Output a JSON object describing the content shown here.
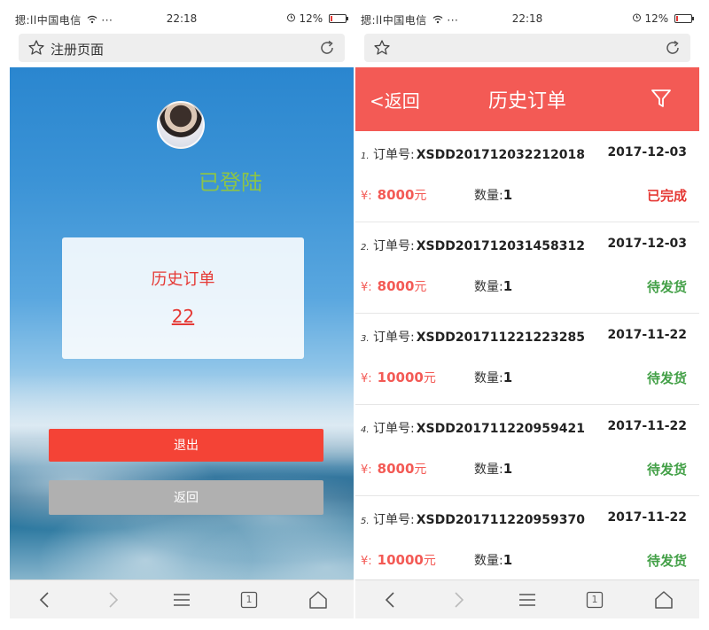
{
  "left_phone": {
    "status": {
      "carrier": "揌:ll中国电信",
      "dots": "···",
      "time": "22:18",
      "battery": "12%",
      "battery_level": 0.12
    },
    "address_bar": {
      "title": "注册页面"
    },
    "login_status": "已登陆",
    "order_card": {
      "title": "历史订单",
      "count": "22"
    },
    "buttons": {
      "logout": "退出",
      "back": "返回"
    },
    "bottom_nav": {
      "tab_count": "1"
    }
  },
  "right_phone": {
    "status": {
      "carrier": "揌:ll中国电信",
      "dots": "···",
      "time": "22:18",
      "battery": "12%",
      "battery_level": 0.12
    },
    "address_bar": {
      "title": ""
    },
    "header": {
      "back": "<返回",
      "title": "历史订单",
      "filter_icon": "filter-icon"
    },
    "order_labels": {
      "no": "订单号:",
      "qty": "数量:",
      "currency": "¥:"
    },
    "orders": [
      {
        "index": "1.",
        "no": "XSDD201712032212018",
        "date": "2017-12-03",
        "amount": "8000",
        "unit": "元",
        "qty": "1",
        "status": "已完成",
        "status_type": "done"
      },
      {
        "index": "2.",
        "no": "XSDD201712031458312",
        "date": "2017-12-03",
        "amount": "8000",
        "unit": "元",
        "qty": "1",
        "status": "待发货",
        "status_type": "pending"
      },
      {
        "index": "3.",
        "no": "XSDD201711221223285",
        "date": "2017-11-22",
        "amount": "10000",
        "unit": "元",
        "qty": "1",
        "status": "待发货",
        "status_type": "pending"
      },
      {
        "index": "4.",
        "no": "XSDD201711220959421",
        "date": "2017-11-22",
        "amount": "8000",
        "unit": "元",
        "qty": "1",
        "status": "待发货",
        "status_type": "pending"
      },
      {
        "index": "5.",
        "no": "XSDD201711220959370",
        "date": "2017-11-22",
        "amount": "10000",
        "unit": "元",
        "qty": "1",
        "status": "待发货",
        "status_type": "pending"
      }
    ],
    "bottom_nav": {
      "tab_count": "1"
    }
  },
  "colors": {
    "header": "#f35a55",
    "done": "#e53935",
    "pending": "#43a047",
    "login_status": "#8bc34a",
    "logout_button": "#f44336",
    "back_button": "#b0b0b0"
  }
}
